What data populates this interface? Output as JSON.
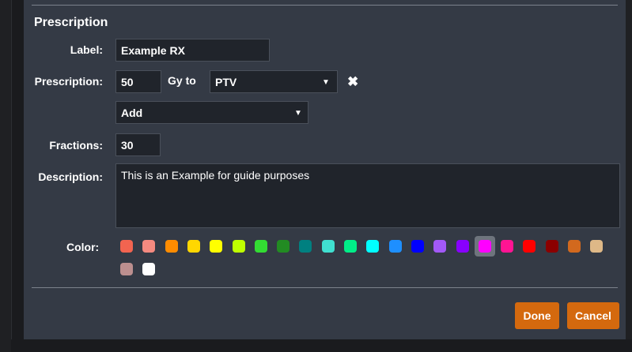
{
  "dialog": {
    "title": "Prescription",
    "label_label": "Label:",
    "label_value": "Example RX",
    "prescription_label": "Prescription:",
    "dose_value": "50",
    "gy_to": "Gy to",
    "target_value": "PTV",
    "add_value": "Add",
    "fractions_label": "Fractions:",
    "fractions_value": "30",
    "description_label": "Description:",
    "description_value": "This is an Example for guide purposes",
    "color_label": "Color:",
    "remove_icon": "close-icon",
    "colors": [
      "#f26450",
      "#f58a80",
      "#ff8c00",
      "#ffd700",
      "#ffff00",
      "#bfff00",
      "#33dd33",
      "#228b22",
      "#008080",
      "#40e0d0",
      "#00ee88",
      "#00ffff",
      "#1e8fff",
      "#0000ff",
      "#a259f7",
      "#8800ff",
      "#ff00ff",
      "#ff1493",
      "#ff0000",
      "#8b0000",
      "#d2691e",
      "#deb887",
      "#bc8f8f",
      "#ffffff"
    ],
    "selected_color": "#ff00ff",
    "done_label": "Done",
    "cancel_label": "Cancel",
    "accent": "#d4690e"
  }
}
